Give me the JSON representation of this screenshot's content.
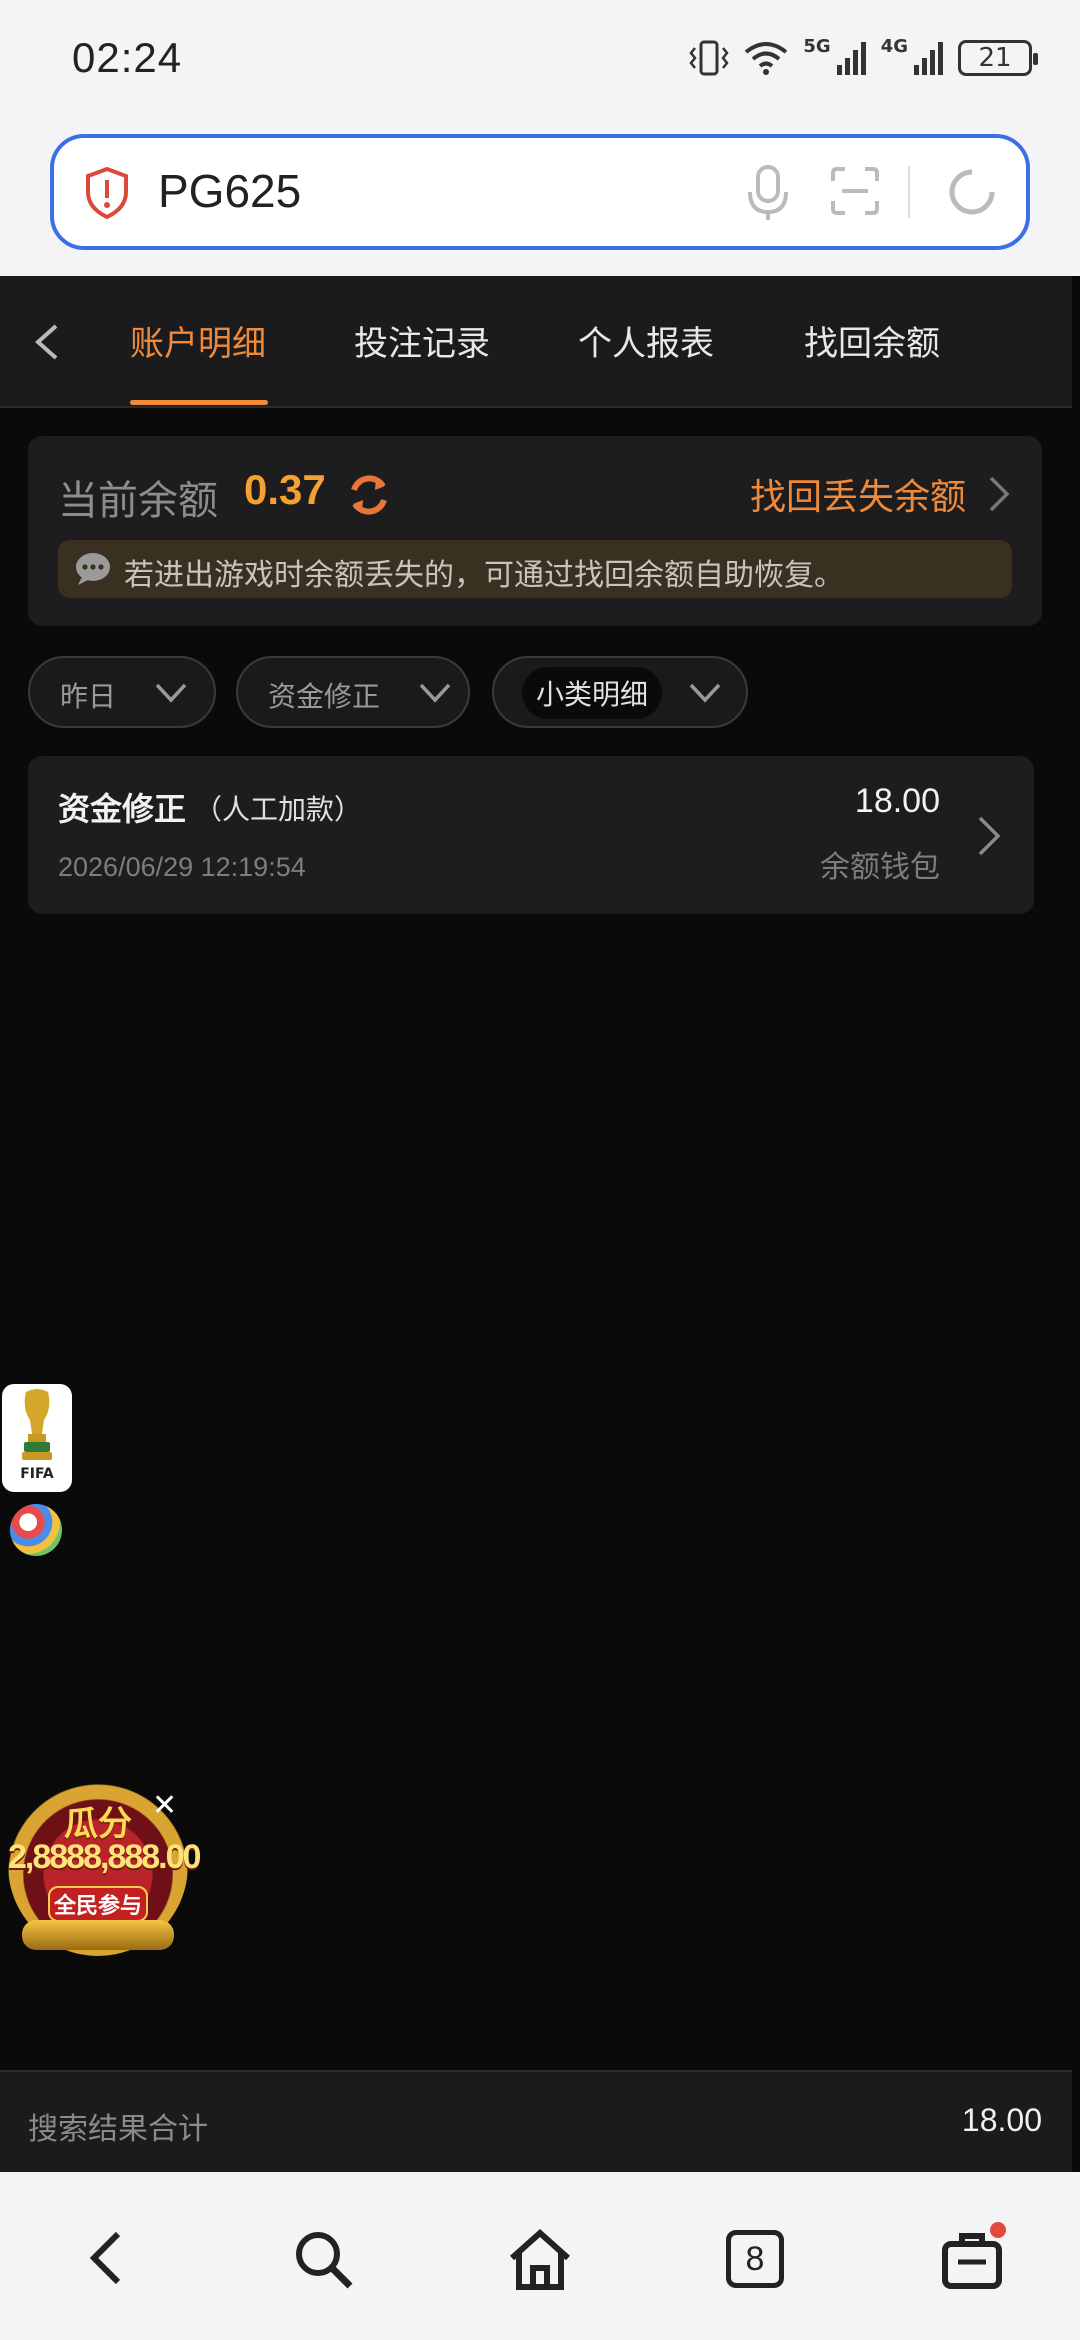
{
  "status": {
    "time": "02:24",
    "net1": "5G",
    "net2": "4G",
    "battery": "21"
  },
  "browser": {
    "url": "PG625"
  },
  "tabs": [
    {
      "label": "账户明细",
      "active": true
    },
    {
      "label": "投注记录"
    },
    {
      "label": "个人报表"
    },
    {
      "label": "找回余额"
    }
  ],
  "balance": {
    "label": "当前余额",
    "value": "0.37",
    "recover_link": "找回丢失余额",
    "notice": "若进出游戏时余额丢失的，可通过找回余额自助恢复。"
  },
  "filters": [
    {
      "label": "昨日"
    },
    {
      "label": "资金修正"
    },
    {
      "label": "小类明细",
      "active": true
    }
  ],
  "records": [
    {
      "title": "资金修正",
      "subtitle": "（人工加款）",
      "time": "2026/06/29 12:19:54",
      "amount": "18.00",
      "wallet": "余额钱包"
    }
  ],
  "widgets": {
    "fifa_label": "FIFA",
    "promo_line1": "瓜分",
    "promo_line2": "2,8888,888.00",
    "promo_line3": "全民参与"
  },
  "summary": {
    "label": "搜索结果合计",
    "total": "18.00"
  },
  "bottom_nav": {
    "tabs_count": "8"
  },
  "colors": {
    "accent": "#f08a3a",
    "balance": "#f5a030",
    "url_border": "#3b6fe8"
  }
}
